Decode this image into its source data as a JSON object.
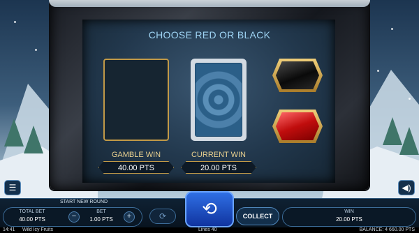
{
  "game": {
    "title": "CHOOSE RED OR BLACK",
    "gamble_win_label": "GAMBLE WIN",
    "gamble_win_value": "40.00 PTS",
    "current_win_label": "CURRENT WIN",
    "current_win_value": "20.00 PTS",
    "black_choice": "black",
    "red_choice": "red"
  },
  "controls": {
    "menu_icon": "menu-icon",
    "sound_icon": "sound-icon",
    "start_new_round": "START NEW ROUND",
    "total_bet_label": "TOTAL BET",
    "total_bet_value": "40.00 PTS",
    "bet_label": "BET",
    "bet_value": "1.00 PTS",
    "minus": "−",
    "plus": "+",
    "collect_label": "COLLECT",
    "win_label": "WIN",
    "win_value": "20.00 PTS"
  },
  "status": {
    "time": "14:41",
    "game_name": "Wild Icy Fruits",
    "lines": "Lines 40",
    "balance": "BALANCE: 4 660.00 PTS"
  },
  "colors": {
    "gold": "#c29a47",
    "title_blue": "#9ed3f3",
    "spin_blue": "#2f6fe4",
    "red_gem": "#c00d0d",
    "black_gem": "#0a0a0a"
  }
}
